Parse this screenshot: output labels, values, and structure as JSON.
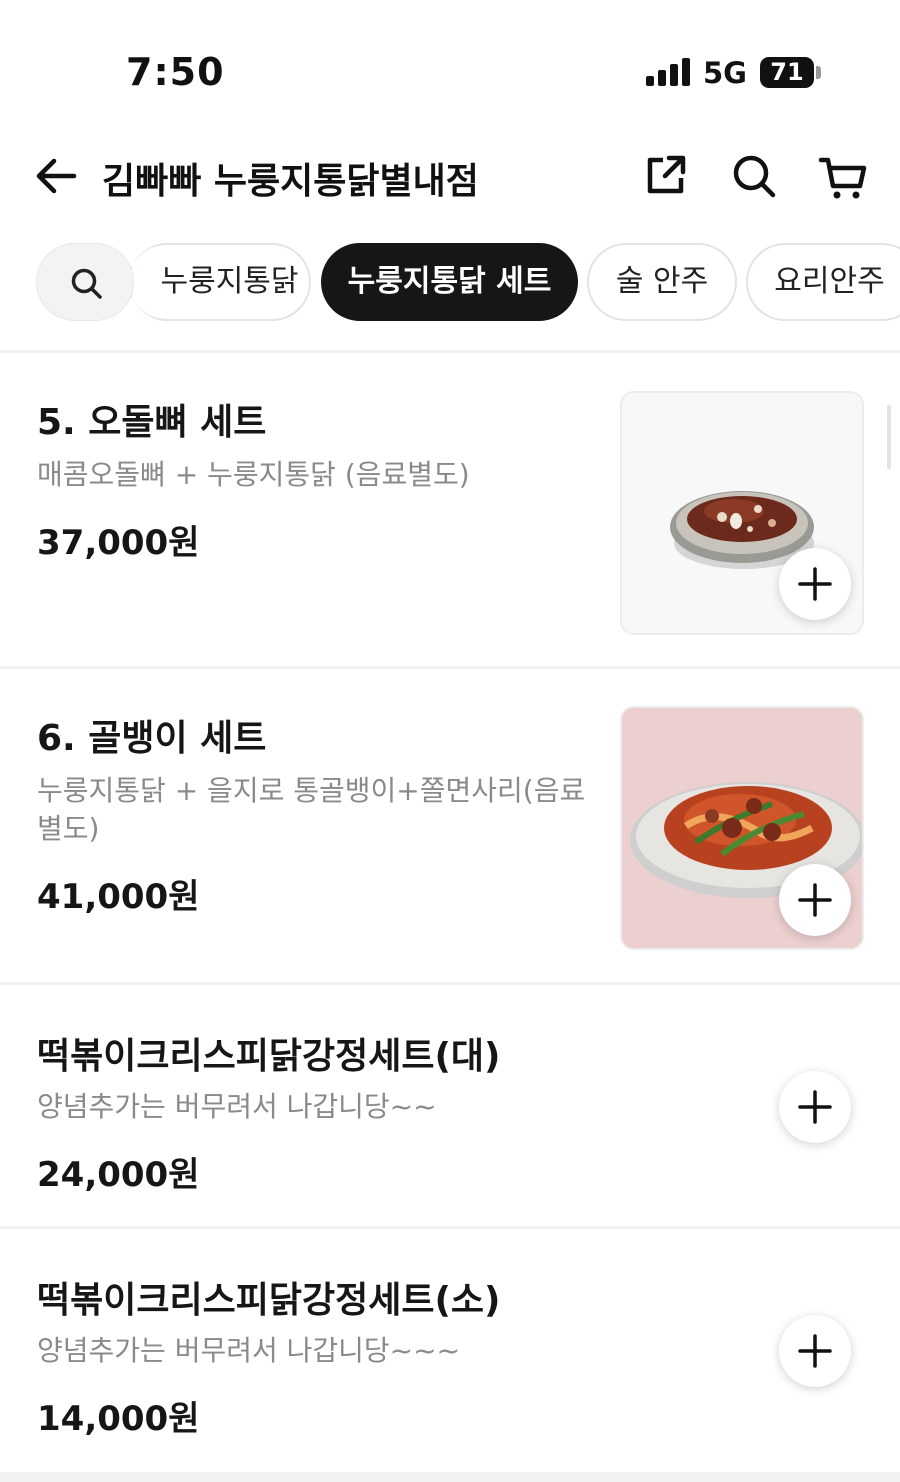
{
  "status_bar": {
    "time": "7:50",
    "network": "5G",
    "battery": "71"
  },
  "header": {
    "title": "김빠빠 누룽지통닭별내점",
    "icons": [
      "back-arrow-icon",
      "share-icon",
      "search-icon",
      "cart-icon"
    ]
  },
  "categories": {
    "items": [
      {
        "label": "누룽지통닭",
        "active": false
      },
      {
        "label": "누룽지통닭 세트",
        "active": true
      },
      {
        "label": "술 안주",
        "active": false
      },
      {
        "label": "요리안주",
        "active": false
      }
    ]
  },
  "menu": {
    "items": [
      {
        "name": "5. 오돌뼈 세트",
        "description": "매콤오돌뼈 + 누룽지통닭 (음료별도)",
        "price": "37,000원"
      },
      {
        "name": "6. 골뱅이 세트",
        "description": "누룽지통닭 + 을지로 통골뱅이+쫄면사리(음료별도)",
        "price": "41,000원"
      },
      {
        "name": "떡볶이크리스피닭강정세트(대)",
        "description": "양념추가는 버무려서 나갑니당~~",
        "price": "24,000원"
      },
      {
        "name": "떡볶이크리스피닭강정세트(소)",
        "description": "양념추가는 버무려서 나갑니당~~~",
        "price": "14,000원"
      }
    ]
  },
  "colors": {
    "active_chip": "#161616",
    "description_text": "#8a8a8a",
    "divider": "#f1f1f3"
  }
}
